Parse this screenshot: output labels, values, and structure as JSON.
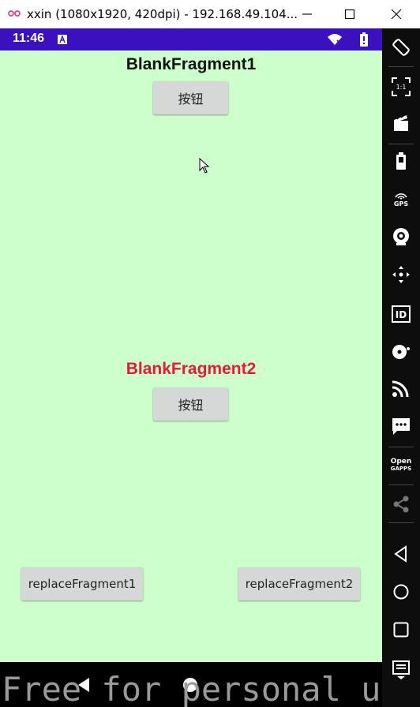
{
  "window": {
    "title": "xxin (1080x1920, 420dpi) - 192.168.49.104..."
  },
  "statusbar": {
    "time": "11:46"
  },
  "fragment1": {
    "title": "BlankFragment1",
    "button_label": "按钮"
  },
  "fragment2": {
    "title": "BlankFragment2",
    "button_label": "按钮"
  },
  "actions": {
    "replace1_label": "replaceFragment1",
    "replace2_label": "replaceFragment2"
  },
  "sidebar": {
    "tools": [
      {
        "icon": "rotate-icon"
      },
      {
        "icon": "pixel-perfect-icon",
        "label": "1:1"
      },
      {
        "icon": "screen-record-icon"
      },
      {
        "icon": "battery-icon"
      },
      {
        "icon": "gps-icon",
        "label": "GPS"
      },
      {
        "icon": "camera-icon"
      },
      {
        "icon": "move-icon"
      },
      {
        "icon": "id-icon",
        "label": "ID"
      },
      {
        "icon": "disk-icon"
      },
      {
        "icon": "network-icon"
      },
      {
        "icon": "sms-icon"
      },
      {
        "icon": "opengapps-icon",
        "label_top": "Open",
        "label_bottom": "GAPPS"
      },
      {
        "icon": "share-icon"
      },
      {
        "icon": "back-icon"
      },
      {
        "icon": "home-icon"
      },
      {
        "icon": "recents-icon"
      },
      {
        "icon": "menu-icon"
      }
    ]
  },
  "watermark": "Free for personal use",
  "colors": {
    "screen_bg": "#ccffcc",
    "statusbar": "#3a10bf",
    "fragment2_title": "#e8183c",
    "button_bg": "#d6d7d7"
  }
}
